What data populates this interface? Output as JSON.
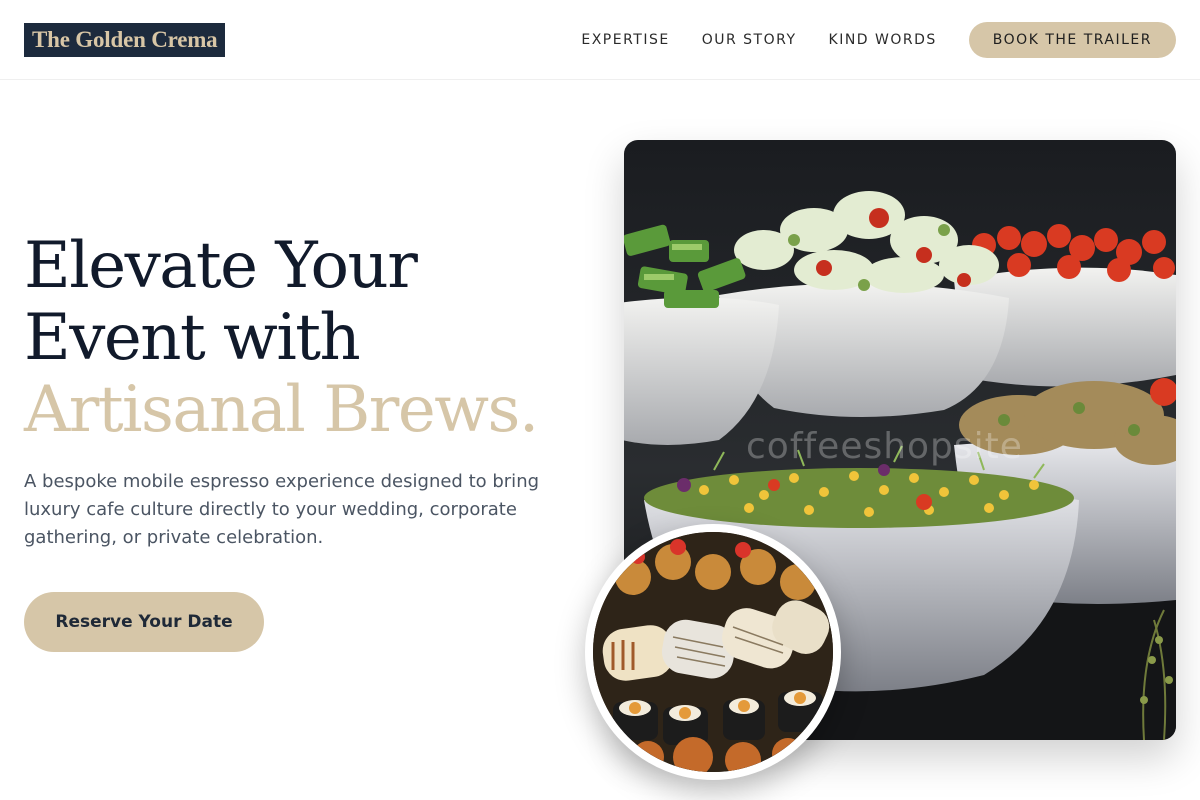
{
  "brand": {
    "name": "The Golden Crema"
  },
  "nav": {
    "items": [
      "EXPERTISE",
      "OUR STORY",
      "KIND WORDS"
    ],
    "cta": "BOOK THE TRAILER"
  },
  "hero": {
    "headline_line1": "Elevate Your",
    "headline_line2": "Event with",
    "headline_accent": "Artisanal Brews.",
    "subheading": "A bespoke mobile espresso experience designed to bring luxury cafe culture directly to your wedding, corporate gathering, or private celebration.",
    "button_label": "Reserve Your Date"
  },
  "images": {
    "main_watermark": "coffeeshopsite"
  },
  "colors": {
    "accent": "#d6c6a8",
    "navy": "#1c2a3d",
    "text_dark": "#111a2b",
    "text_muted": "#4b5563"
  }
}
